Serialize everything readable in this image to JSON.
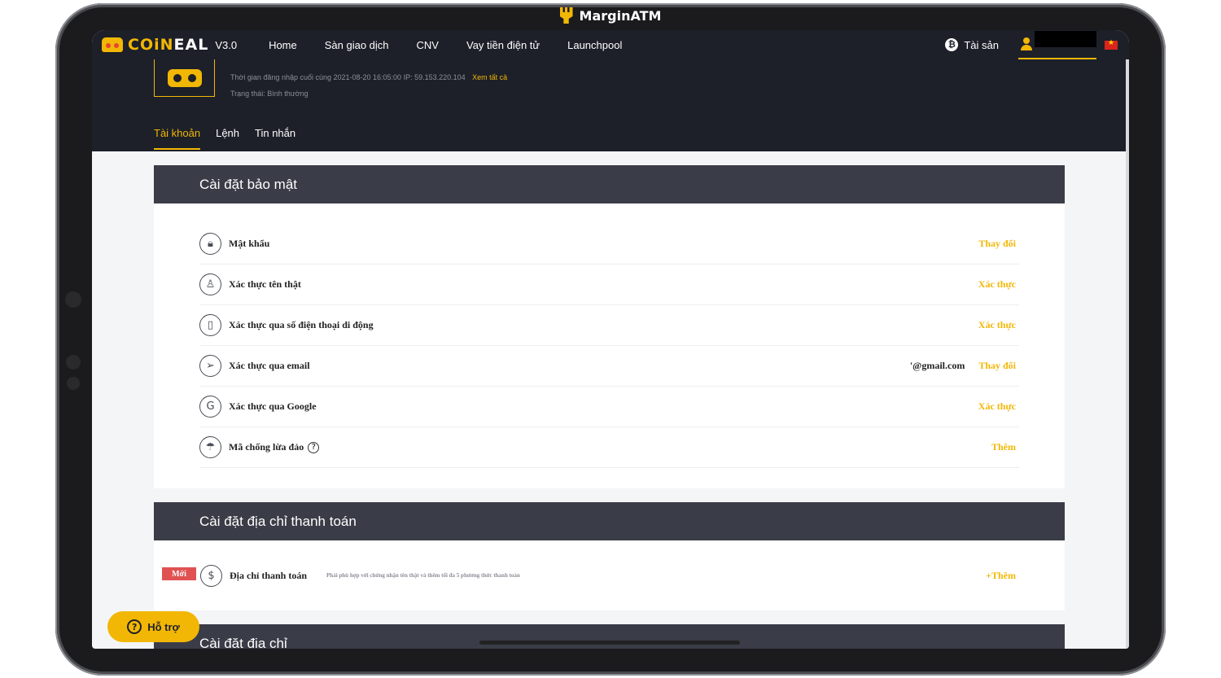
{
  "brand": {
    "app_title": "MarginATM"
  },
  "nav": {
    "logo_text_a": "COiN",
    "logo_text_b": "EAL",
    "version": "V3.0",
    "links": [
      "Home",
      "Sàn giao dịch",
      "CNV",
      "Vay tiền điện tử",
      "Launchpool"
    ],
    "assets": "Tài sản"
  },
  "account": {
    "login_info": "Thời gian đăng nhập cuối cùng 2021-08-20 16:05:00 IP: 59.153.220.104",
    "see_all": "Xem tất cả",
    "status": "Trạng thái: Bình thường",
    "tabs": [
      "Tài khoản",
      "Lệnh",
      "Tin nhắn"
    ]
  },
  "security": {
    "title": "Cài đặt bảo mật",
    "rows": [
      {
        "icon": "lock-icon",
        "label": "Mật khẩu",
        "value": "",
        "action": "Thay đổi"
      },
      {
        "icon": "person-icon",
        "label": "Xác thực tên thật",
        "value": "",
        "action": "Xác thực"
      },
      {
        "icon": "phone-icon",
        "label": "Xác thực qua số điện thoại di động",
        "value": "",
        "action": "Xác thực"
      },
      {
        "icon": "send-icon",
        "label": "Xác thực qua email",
        "value": "'@gmail.com",
        "action": "Thay đổi"
      },
      {
        "icon": "google-icon",
        "label": "Xác thực qua Google",
        "value": "",
        "action": "Xác thực"
      },
      {
        "icon": "umbrella-icon",
        "label": "Mã chống lừa đảo",
        "value": "",
        "action": "Thêm"
      }
    ]
  },
  "payment": {
    "title": "Cài đặt địa chỉ thanh toán",
    "badge": "Mới",
    "label": "Địa chỉ thanh toán",
    "note": "Phải phù hợp với chứng nhận tên thật và thêm tối đa 5 phương thức thanh toán",
    "action": "+Thêm"
  },
  "address": {
    "title": "Cài đặt địa chỉ"
  },
  "support": {
    "label": "Hỗ trợ"
  },
  "colors": {
    "accent": "#f2b705",
    "nav_bg": "#1d2029",
    "panel_head": "#3a3d47",
    "badge": "#e05252"
  }
}
